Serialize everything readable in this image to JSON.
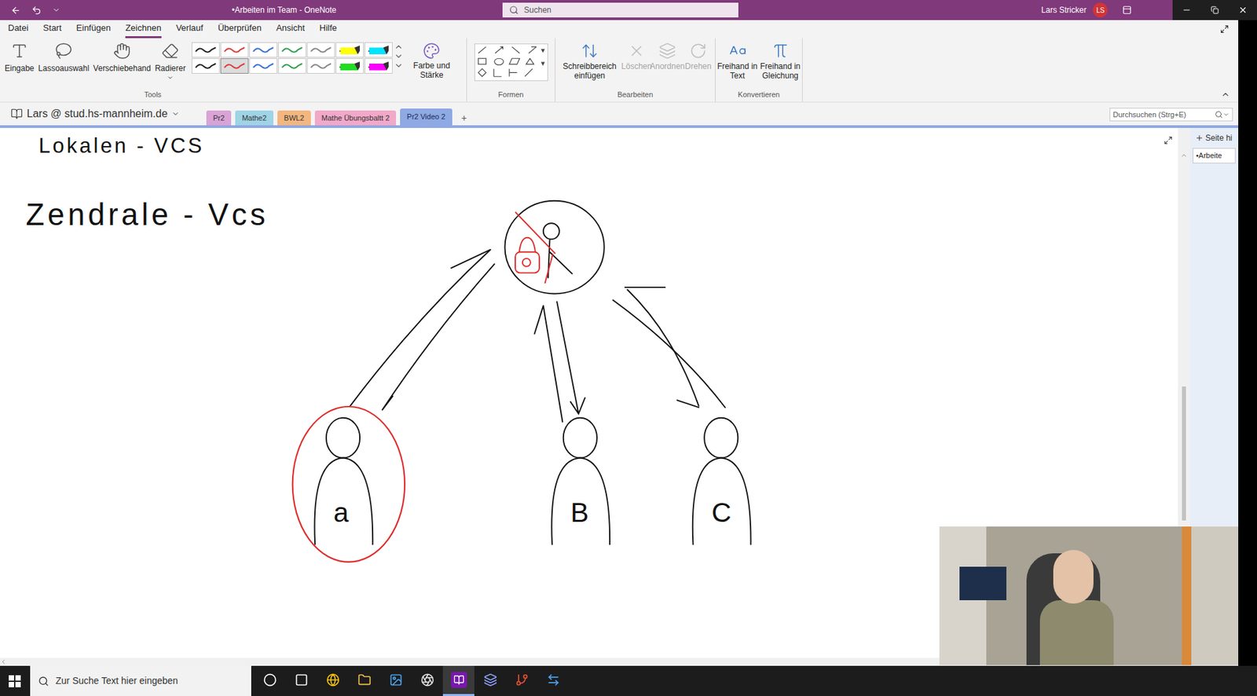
{
  "window": {
    "title": "•Arbeiten im Team - OneNote",
    "search_placeholder": "Suchen",
    "user": "Lars Stricker",
    "avatar": "LS"
  },
  "menu": [
    {
      "label": "Datei",
      "selected": false
    },
    {
      "label": "Start",
      "selected": false
    },
    {
      "label": "Einfügen",
      "selected": false
    },
    {
      "label": "Zeichnen",
      "selected": true
    },
    {
      "label": "Verlauf",
      "selected": false
    },
    {
      "label": "Überprüfen",
      "selected": false
    },
    {
      "label": "Ansicht",
      "selected": false
    },
    {
      "label": "Hilfe",
      "selected": false
    }
  ],
  "ribbon": {
    "tools": [
      {
        "label": "Eingabe",
        "kind": "type",
        "has_menu": false
      },
      {
        "label": "Lassoauswahl",
        "kind": "lasso",
        "has_menu": false
      },
      {
        "label": "Verschiebehand",
        "kind": "hand",
        "has_menu": false
      },
      {
        "label": "Radierer",
        "kind": "eraser",
        "has_menu": true
      }
    ],
    "pens": [
      {
        "kind": "pen",
        "color": "#222222",
        "selected": false
      },
      {
        "kind": "pen",
        "color": "#e03a3a",
        "selected": false
      },
      {
        "kind": "pen",
        "color": "#3a6fd8",
        "selected": false
      },
      {
        "kind": "pen",
        "color": "#2e9e4f",
        "selected": false
      },
      {
        "kind": "pen",
        "color": "#888888",
        "selected": false
      },
      {
        "kind": "highlighter",
        "color": "#ffff00",
        "selected": false
      },
      {
        "kind": "highlighter",
        "color": "#00e5ff",
        "selected": false
      },
      {
        "kind": "pen",
        "color": "#222222",
        "selected": false
      },
      {
        "kind": "pen",
        "color": "#e03a3a",
        "selected": true
      },
      {
        "kind": "pen",
        "color": "#3a6fd8",
        "selected": false
      },
      {
        "kind": "pen",
        "color": "#2e9e4f",
        "selected": false
      },
      {
        "kind": "pen",
        "color": "#888888",
        "selected": false
      },
      {
        "kind": "highlighter",
        "color": "#22dd22",
        "selected": false
      },
      {
        "kind": "highlighter",
        "color": "#ff00ff",
        "selected": false
      }
    ],
    "color_button": "Farbe und Stärke",
    "tools_group": "Tools",
    "shapes_group": "Formen",
    "edit": [
      {
        "label": "Schreibbereich einfügen",
        "kind": "insert-space",
        "disabled": false
      },
      {
        "label": "Löschen",
        "kind": "delete",
        "disabled": true
      },
      {
        "label": "Anordnen",
        "kind": "arrange",
        "disabled": true
      },
      {
        "label": "Drehen",
        "kind": "rotate",
        "disabled": true
      }
    ],
    "edit_group": "Bearbeiten",
    "convert": [
      {
        "label": "Freihand in Text",
        "kind": "ink-text"
      },
      {
        "label": "Freihand in Gleichung",
        "kind": "ink-math"
      }
    ],
    "convert_group": "Konvertieren"
  },
  "notebook": {
    "name": "Lars @ stud.hs-mannheim.de",
    "sections": [
      {
        "label": "Pr2",
        "color": "#d9a3d6",
        "selected": false
      },
      {
        "label": "Mathe2",
        "color": "#9fd3e6",
        "selected": false
      },
      {
        "label": "BWL2",
        "color": "#f3b67f",
        "selected": false
      },
      {
        "label": "Mathe Übungsbaltt 2",
        "color": "#f2a8c8",
        "selected": false
      },
      {
        "label": "Pr2 Video 2",
        "color": "#8ea9e3",
        "selected": true
      }
    ],
    "add": "+",
    "search_placeholder": "Durchsuchen (Strg+E)"
  },
  "pages": {
    "add": "Seite hi",
    "items": [
      {
        "label": "•Arbeite",
        "selected": true
      }
    ]
  },
  "canvas": {
    "headings": [
      "Lokalen - VCS",
      "Zendrale - Vcs"
    ],
    "people": [
      {
        "label": "a",
        "highlighted": true
      },
      {
        "label": "B",
        "highlighted": false
      },
      {
        "label": "C",
        "highlighted": false
      }
    ],
    "server_locked": true
  },
  "taskbar": {
    "search_placeholder": "Zur Suche Text hier eingeben",
    "apps": [
      {
        "kind": "cortana",
        "active": false
      },
      {
        "kind": "taskview",
        "active": false
      },
      {
        "kind": "chrome",
        "active": false
      },
      {
        "kind": "explorer",
        "active": false
      },
      {
        "kind": "photos",
        "active": false
      },
      {
        "kind": "obs",
        "active": false
      },
      {
        "kind": "onenote",
        "active": true
      },
      {
        "kind": "vpn",
        "active": false
      },
      {
        "kind": "git",
        "active": false
      },
      {
        "kind": "teamviewer",
        "active": false
      }
    ]
  }
}
